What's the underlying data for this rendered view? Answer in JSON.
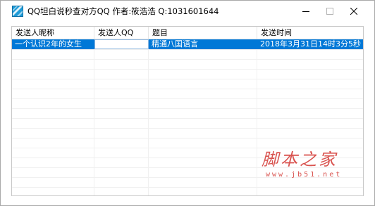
{
  "window": {
    "title": "QQ坦白说秒查对方QQ 作者:筱浩浩 Q:1031601644",
    "icon": "app-icon"
  },
  "controls": {
    "minimize_icon": "minimize-icon",
    "maximize_icon": "maximize-icon",
    "close_icon": "close-icon"
  },
  "table": {
    "columns": [
      "发送人昵称",
      "发送人QQ",
      "题目",
      "发送时间"
    ],
    "rows": [
      [
        "一个认识2年的女生",
        "",
        "精通八国语言",
        "2018年3月31日14时3分5秒"
      ]
    ]
  },
  "watermark": {
    "logo": "脚本之家",
    "url": "www.jb51.net",
    "color": "#d9534f"
  },
  "colors": {
    "selection": "#0078d7",
    "window_border": "#a9a9a9"
  }
}
